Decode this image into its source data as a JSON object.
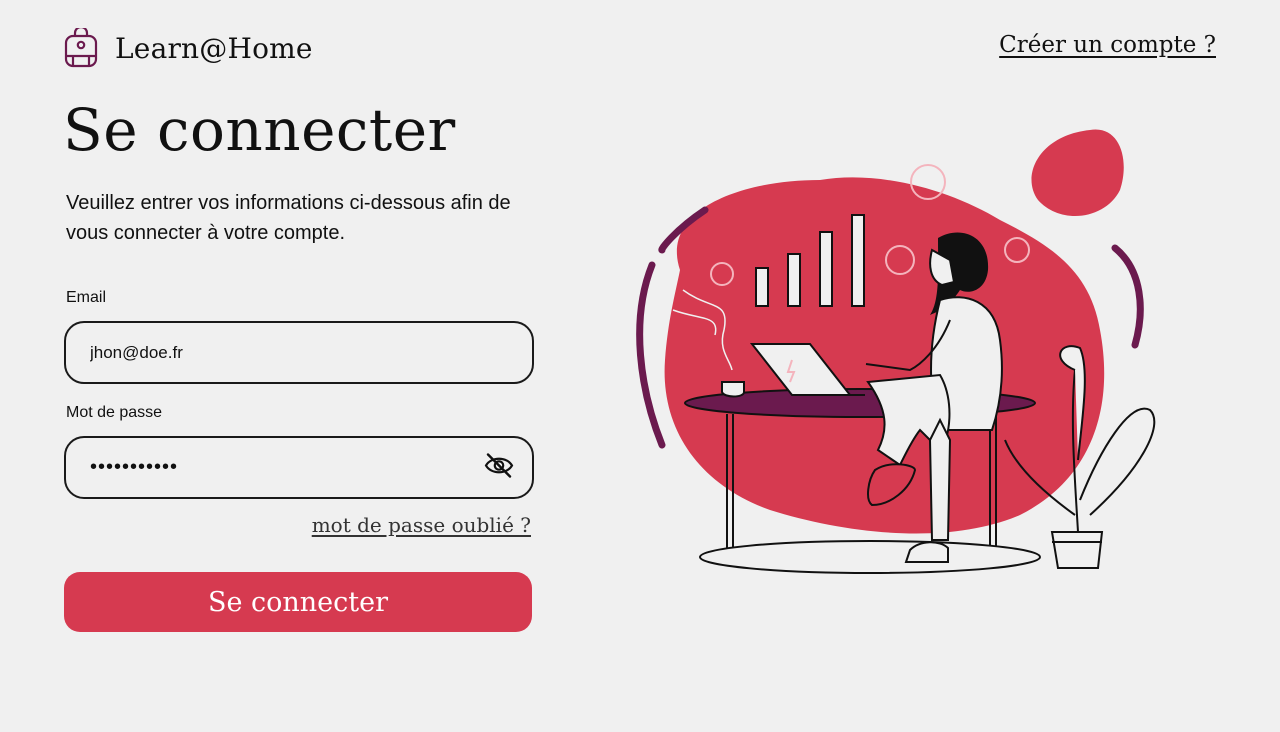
{
  "header": {
    "brand": "Learn@Home",
    "create_account_link": "Créer un compte ?"
  },
  "main": {
    "title": "Se connecter",
    "subtitle": "Veuillez entrer vos informations ci-dessous afin de vous connecter à votre compte."
  },
  "form": {
    "email_label": "Email",
    "email_value": "jhon@doe.fr",
    "password_label": "Mot de passe",
    "password_value": "•••••••••••",
    "forgot_password_link": "mot de passe oublié ?",
    "submit_label": "Se connecter"
  },
  "icons": {
    "logo": "backpack-icon",
    "password_toggle": "eye-off-icon"
  },
  "colors": {
    "accent": "#d63a50",
    "brand_dark": "#6b1a4e",
    "background": "#f0f0f0"
  }
}
